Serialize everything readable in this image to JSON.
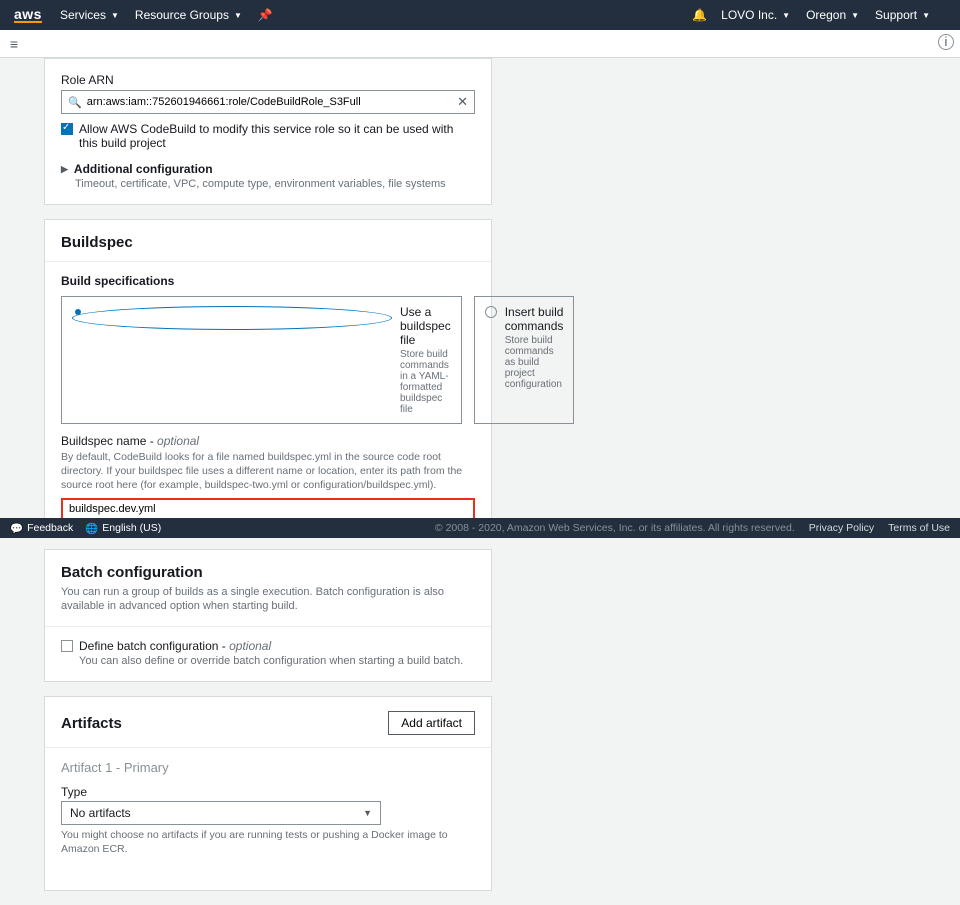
{
  "topnav": {
    "logo": "aws",
    "services": "Services",
    "resourceGroups": "Resource Groups",
    "account": "LOVO Inc.",
    "region": "Oregon",
    "support": "Support"
  },
  "env": {
    "roleArnLabel": "Role ARN",
    "roleArnValue": "arn:aws:iam::752601946661:role/CodeBuildRole_S3Full",
    "allowModify": "Allow AWS CodeBuild to modify this service role so it can be used with this build project",
    "additional": "Additional configuration",
    "additionalDesc": "Timeout, certificate, VPC, compute type, environment variables, file systems"
  },
  "buildspec": {
    "title": "Buildspec",
    "subhead": "Build specifications",
    "opt1": {
      "title": "Use a buildspec file",
      "desc": "Store build commands in a YAML-formatted buildspec file"
    },
    "opt2": {
      "title": "Insert build commands",
      "desc": "Store build commands as build project configuration"
    },
    "nameLabel": "Buildspec name - ",
    "optional": "optional",
    "nameDesc": "By default, CodeBuild looks for a file named buildspec.yml in the source code root directory. If your buildspec file uses a different name or location, enter its path from the source root here (for example, buildspec-two.yml or configuration/buildspec.yml).",
    "nameValue": "buildspec.dev.yml"
  },
  "batch": {
    "title": "Batch configuration",
    "desc": "You can run a group of builds as a single execution. Batch configuration is also available in advanced option when starting build.",
    "ck": "Define batch configuration - ",
    "optional": "optional",
    "ckDesc": "You can also define or override batch configuration when starting a build batch."
  },
  "artifacts": {
    "title": "Artifacts",
    "add": "Add artifact",
    "sub": "Artifact 1 - Primary",
    "typeLabel": "Type",
    "typeValue": "No artifacts",
    "note": "You might choose no artifacts if you are running tests or pushing a Docker image to Amazon ECR."
  },
  "footer": {
    "feedback": "Feedback",
    "lang": "English (US)",
    "copy": "© 2008 - 2020, Amazon Web Services, Inc. or its affiliates. All rights reserved.",
    "privacy": "Privacy Policy",
    "terms": "Terms of Use"
  }
}
